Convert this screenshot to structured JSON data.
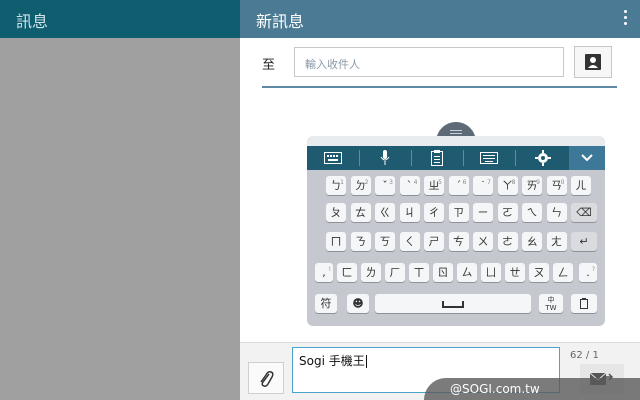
{
  "left_pane": {
    "title": "訊息"
  },
  "right_pane": {
    "title": "新訊息",
    "recipient": {
      "label": "至",
      "placeholder": "輸入收件人"
    }
  },
  "keyboard": {
    "toolbar": [
      "keyboard-icon",
      "microphone-icon",
      "clipboard-icon",
      "keyboard-layout-icon",
      "gear-icon",
      "chevron-down-icon"
    ],
    "row1": [
      {
        "k": "ㄅ",
        "s": "1"
      },
      {
        "k": "ㄉ",
        "s": "2"
      },
      {
        "k": "ˇ",
        "s": "3"
      },
      {
        "k": "ˋ",
        "s": "4"
      },
      {
        "k": "ㄓ",
        "s": "5"
      },
      {
        "k": "ˊ",
        "s": "6"
      },
      {
        "k": "˙",
        "s": "7"
      },
      {
        "k": "ㄚ",
        "s": "8"
      },
      {
        "k": "ㄞ",
        "s": "9"
      },
      {
        "k": "ㄢ",
        "s": "0"
      },
      {
        "k": "ㄦ",
        "s": ""
      }
    ],
    "row2": [
      "ㄆ",
      "ㄊ",
      "ㄍ",
      "ㄐ",
      "ㄔ",
      "ㄗ",
      "ㄧ",
      "ㄛ",
      "ㄟ",
      "ㄣ"
    ],
    "row3": [
      "ㄇ",
      "ㄋ",
      "ㄎ",
      "ㄑ",
      "ㄕ",
      "ㄘ",
      "ㄨ",
      "ㄜ",
      "ㄠ",
      "ㄤ"
    ],
    "row4": [
      {
        "k": ",",
        "s": "!"
      },
      {
        "k": "ㄈ",
        "s": ""
      },
      {
        "k": "ㄌ",
        "s": ""
      },
      {
        "k": "ㄏ",
        "s": ""
      },
      {
        "k": "ㄒ",
        "s": ""
      },
      {
        "k": "ㄖ",
        "s": ""
      },
      {
        "k": "ㄙ",
        "s": ""
      },
      {
        "k": "ㄩ",
        "s": ""
      },
      {
        "k": "ㄝ",
        "s": ""
      },
      {
        "k": "ㄡ",
        "s": ""
      },
      {
        "k": "ㄥ",
        "s": ""
      },
      {
        "k": ".",
        "s": "?"
      }
    ],
    "row5": {
      "symbols": "符",
      "emoji": "☻",
      "lang_top": "中",
      "lang_bottom": "TW"
    },
    "backspace": "⌫",
    "enter": "↵"
  },
  "compose": {
    "message": "Sogi 手機王",
    "counter": "62 / 1"
  },
  "watermark": "@SOGI.com.tw"
}
